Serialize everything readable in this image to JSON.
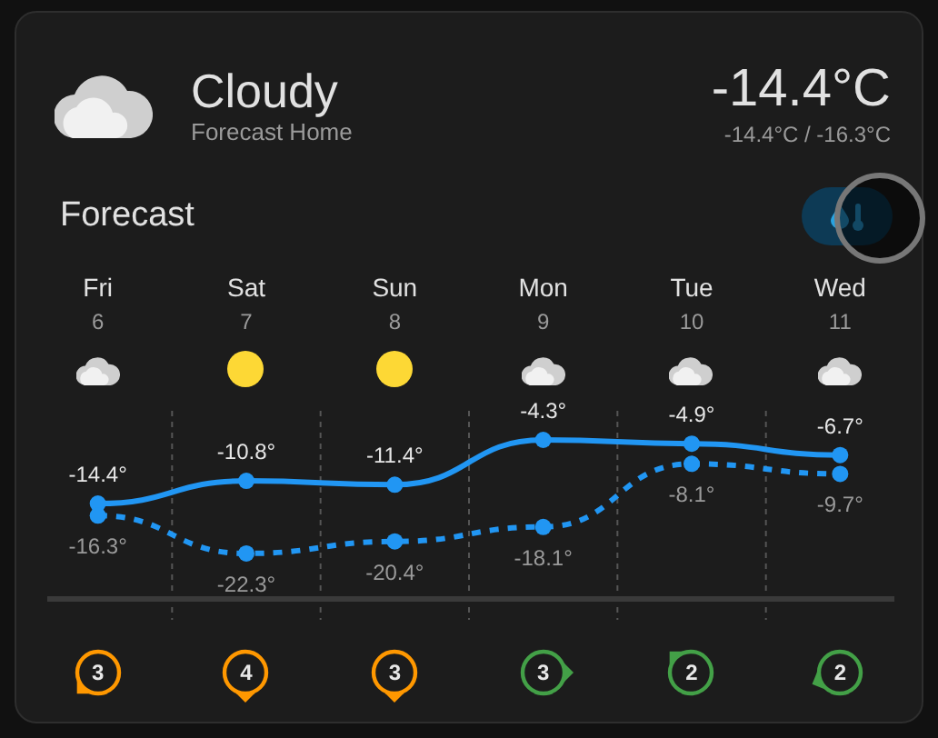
{
  "current": {
    "condition": "Cloudy",
    "kind": "cloudy",
    "location": "Forecast Home",
    "temperature": "-14.4°C",
    "high_low": "-14.4°C / -16.3°C"
  },
  "forecast": {
    "title": "Forecast",
    "toggle": {
      "selected": true
    },
    "days": [
      {
        "day": "Fri",
        "date": "6",
        "kind": "cloudy",
        "wind": {
          "speed": "3",
          "kind": "southwest",
          "color": "#ff9800"
        }
      },
      {
        "day": "Sat",
        "date": "7",
        "kind": "sunny",
        "wind": {
          "speed": "4",
          "kind": "south",
          "color": "#ff9800"
        }
      },
      {
        "day": "Sun",
        "date": "8",
        "kind": "sunny",
        "wind": {
          "speed": "3",
          "kind": "south",
          "color": "#ff9800"
        }
      },
      {
        "day": "Mon",
        "date": "9",
        "kind": "cloudy",
        "wind": {
          "speed": "3",
          "kind": "east",
          "color": "#43a047"
        }
      },
      {
        "day": "Tue",
        "date": "10",
        "kind": "cloudy",
        "wind": {
          "speed": "2",
          "kind": "northwest",
          "color": "#43a047"
        }
      },
      {
        "day": "Wed",
        "date": "11",
        "kind": "cloudy",
        "wind": {
          "speed": "2",
          "kind": "westsouthwest",
          "color": "#43a047"
        }
      }
    ],
    "chart_data": {
      "type": "line",
      "data_labels": true,
      "series": [
        {
          "color": "#2196f3",
          "line_style": "solid",
          "marker": "circle",
          "values": [
            -14.4,
            -10.8,
            -11.4,
            -4.3,
            -4.9,
            -6.7
          ],
          "value_labels": [
            "-14.4°",
            "-10.8°",
            "-11.4°",
            "-4.3°",
            "-4.9°",
            "-6.7°"
          ]
        },
        {
          "color": "#2196f3",
          "line_style": "dashed",
          "marker": "circle",
          "values": [
            -16.3,
            -22.3,
            -20.4,
            -18.1,
            -8.1,
            -9.7
          ],
          "value_labels": [
            "-16.3°",
            "-22.3°",
            "-20.4°",
            "-18.1°",
            "-8.1°",
            "-9.7°"
          ]
        }
      ]
    }
  }
}
